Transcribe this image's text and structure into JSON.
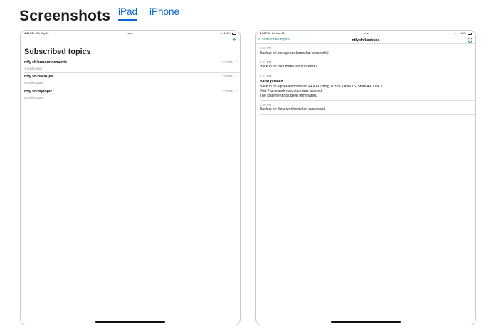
{
  "header": {
    "title": "Screenshots",
    "tabs": [
      {
        "label": "iPad",
        "active": true
      },
      {
        "label": "iPhone",
        "active": false
      }
    ]
  },
  "status_bar": {
    "time": "4:09 PM",
    "date": "Sat May 21",
    "battery": "100%"
  },
  "topics_screen": {
    "add_icon": "plus-icon",
    "title": "Subscribed topics",
    "topics": [
      {
        "name": "ntfy.sh/announcements",
        "count": "1 notification",
        "time": "12:22 PM"
      },
      {
        "name": "ntfy.sh/backups",
        "count": "4 notifications",
        "time": "2:53 PM"
      },
      {
        "name": "ntfy.sh/mytopic",
        "count": "5 notifications",
        "time": "3:27 PM"
      }
    ]
  },
  "detail_screen": {
    "back_label": "Subscribed topics",
    "title": "ntfy.sh/backups",
    "more_icon": "ellipsis-circle-icon",
    "messages": [
      {
        "time": "2:53 PM",
        "title": "",
        "body": "Backup on storagebox.home.lan successful"
      },
      {
        "time": "2:52 PM",
        "title": "",
        "body": "Backup on plex.home.lan successful"
      },
      {
        "time": "2:52 PM",
        "title": "Backup failed",
        "body": "Backup on sqlserver.home.lan FAILED: Msg 10329, Level 16, State 49, Line 7\n.Net Framework execution was aborted.\nThe statement has been terminated."
      },
      {
        "time": "2:50 PM",
        "title": "",
        "body": "Backup on fileserver.home.lan successful"
      }
    ]
  },
  "colors": {
    "accent": "#1e8a7a",
    "tab_link": "#0b66d0"
  }
}
